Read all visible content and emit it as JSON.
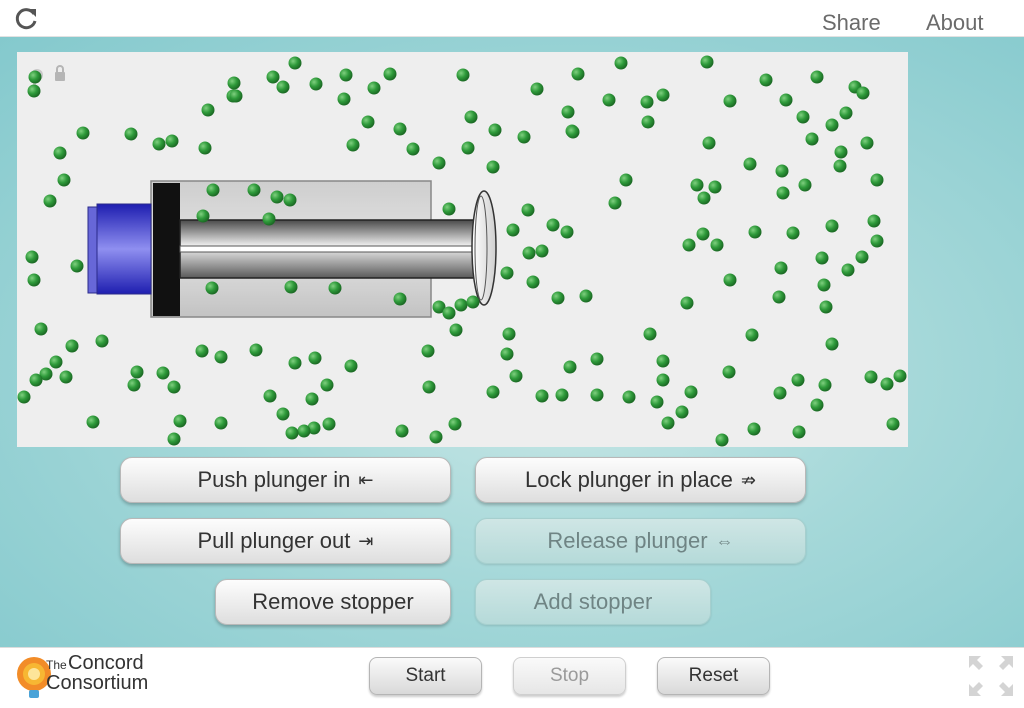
{
  "header": {
    "share_label": "Share",
    "about_label": "About"
  },
  "controls": {
    "push_label": "Push plunger in",
    "push_arrow": "⇤",
    "lock_label": "Lock plunger in place",
    "lock_arrow": "⇏",
    "pull_label": "Pull plunger out",
    "pull_arrow": "⇥",
    "release_label": "Release plunger",
    "release_arrow": "⇔",
    "remove_stopper_label": "Remove stopper",
    "add_stopper_label": "Add stopper"
  },
  "footer": {
    "logo_the": "The",
    "logo_concord": "Concord",
    "logo_consortium": "Consortium",
    "start_label": "Start",
    "stop_label": "Stop",
    "reset_label": "Reset"
  },
  "colors": {
    "molecule": "#2e9a3a",
    "plunger_head": "#3a3ad8",
    "stage": "#9ad3d4"
  },
  "icons": [
    "reload-icon",
    "lock-icon",
    "fullscreen-icon"
  ]
}
